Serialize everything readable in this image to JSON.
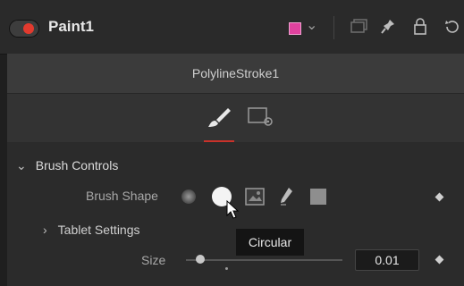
{
  "node": {
    "title": "Paint1",
    "enabled": true,
    "color": "#e0429e"
  },
  "tool": {
    "name": "PolylineStroke1"
  },
  "tabs": [
    {
      "icon": "paintbrush-icon",
      "active": true
    },
    {
      "icon": "settings-panel-icon",
      "active": false
    }
  ],
  "brush_controls": {
    "section_label": "Brush Controls",
    "brush_shape_label": "Brush Shape",
    "shapes": [
      "soft-brush-icon",
      "circular-brush-icon",
      "image-brush-icon",
      "eraser-brush-icon",
      "square-brush-icon"
    ],
    "selected_shape": "Circular",
    "tooltip": "Circular"
  },
  "tablet_settings": {
    "label": "Tablet Settings"
  },
  "size": {
    "label": "Size",
    "value": "0.01"
  }
}
